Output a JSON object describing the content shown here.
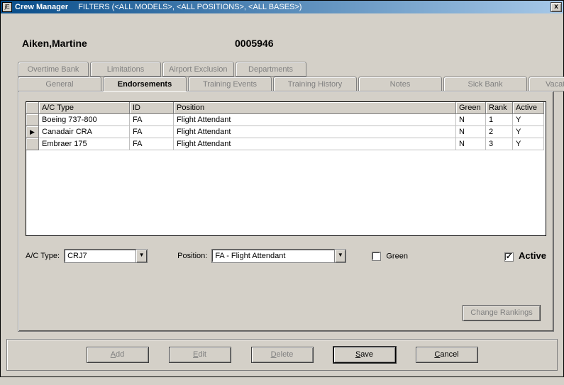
{
  "window": {
    "title": "Crew Manager",
    "filters": "FILTERS (<ALL MODELS>, <ALL POSITIONS>, <ALL BASES>)",
    "icon_glyph": "jE",
    "close_glyph": "x"
  },
  "person": {
    "name": "Aiken,Martine",
    "id": "0005946"
  },
  "tabs_top": [
    {
      "key": "overtime",
      "label": "Overtime Bank"
    },
    {
      "key": "limitations",
      "label": "Limitations"
    },
    {
      "key": "airport_exclusion",
      "label": "Airport Exclusion"
    },
    {
      "key": "departments",
      "label": "Departments"
    }
  ],
  "tabs_bottom": [
    {
      "key": "general",
      "label": "General"
    },
    {
      "key": "endorsements",
      "label": "Endorsements",
      "active": true
    },
    {
      "key": "training_events",
      "label": "Training Events"
    },
    {
      "key": "training_history",
      "label": "Training History"
    },
    {
      "key": "notes",
      "label": "Notes"
    },
    {
      "key": "sick_bank",
      "label": "Sick Bank"
    },
    {
      "key": "vacation_bank",
      "label": "Vacation Bank"
    }
  ],
  "grid": {
    "headers": {
      "ac_type": "A/C Type",
      "id": "ID",
      "position": "Position",
      "green": "Green",
      "rank": "Rank",
      "active": "Active"
    },
    "rows": [
      {
        "ac_type": "Boeing 737-800",
        "id": "FA",
        "position": "Flight Attendant",
        "green": "N",
        "rank": "1",
        "active": "Y",
        "current": false
      },
      {
        "ac_type": "Canadair  CRA",
        "id": "FA",
        "position": "Flight Attendant",
        "green": "N",
        "rank": "2",
        "active": "Y",
        "current": true
      },
      {
        "ac_type": "Embraer 175",
        "id": "FA",
        "position": "Flight Attendant",
        "green": "N",
        "rank": "3",
        "active": "Y",
        "current": false
      }
    ],
    "row_marker": "▶"
  },
  "form": {
    "ac_type_label": "A/C Type:",
    "ac_type_value": "CRJ7",
    "position_label": "Position:",
    "position_value": "FA  - Flight Attendant",
    "green_label": "Green",
    "green_checked": false,
    "active_label": "Active",
    "active_checked": true,
    "change_rankings": "Change Rankings",
    "dropdown_glyph": "▼"
  },
  "buttons": {
    "add": {
      "pre": "",
      "u": "A",
      "post": "dd"
    },
    "edit": {
      "pre": "",
      "u": "E",
      "post": "dit"
    },
    "delete": {
      "pre": "",
      "u": "D",
      "post": "elete"
    },
    "save": {
      "pre": "",
      "u": "S",
      "post": "ave"
    },
    "cancel": {
      "pre": "",
      "u": "C",
      "post": "ancel"
    }
  }
}
